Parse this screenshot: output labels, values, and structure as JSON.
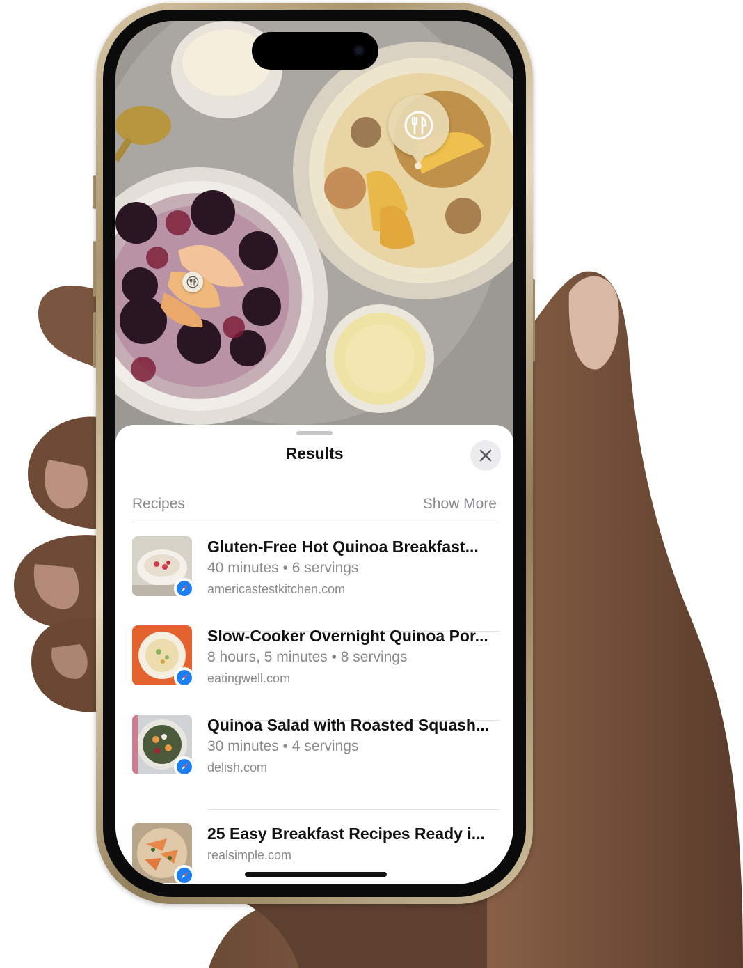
{
  "sheet": {
    "title": "Results",
    "close_icon": "xmark-icon"
  },
  "section": {
    "label": "Recipes",
    "show_more": "Show More"
  },
  "results": [
    {
      "title": "Gluten-Free Hot Quinoa Breakfast...",
      "meta": "40 minutes • 6 servings",
      "site": "americastestkitchen.com",
      "badge_icon": "safari-icon"
    },
    {
      "title": "Slow-Cooker Overnight Quinoa Por...",
      "meta": "8 hours, 5 minutes • 8 servings",
      "site": "eatingwell.com",
      "badge_icon": "safari-icon"
    },
    {
      "title": "Quinoa Salad with Roasted Squash...",
      "meta": "30 minutes • 4 servings",
      "site": "delish.com",
      "badge_icon": "safari-icon"
    },
    {
      "title": "25 Easy Breakfast Recipes Ready i...",
      "meta": "",
      "site": "realsimple.com",
      "badge_icon": "safari-icon"
    }
  ],
  "photo": {
    "lookup_icon": "fork-knife-icon"
  },
  "colors": {
    "accent_blue": "#1d7ff2",
    "secondary_text": "#8a8a8e",
    "pin_beige": "#e8d9b2"
  }
}
